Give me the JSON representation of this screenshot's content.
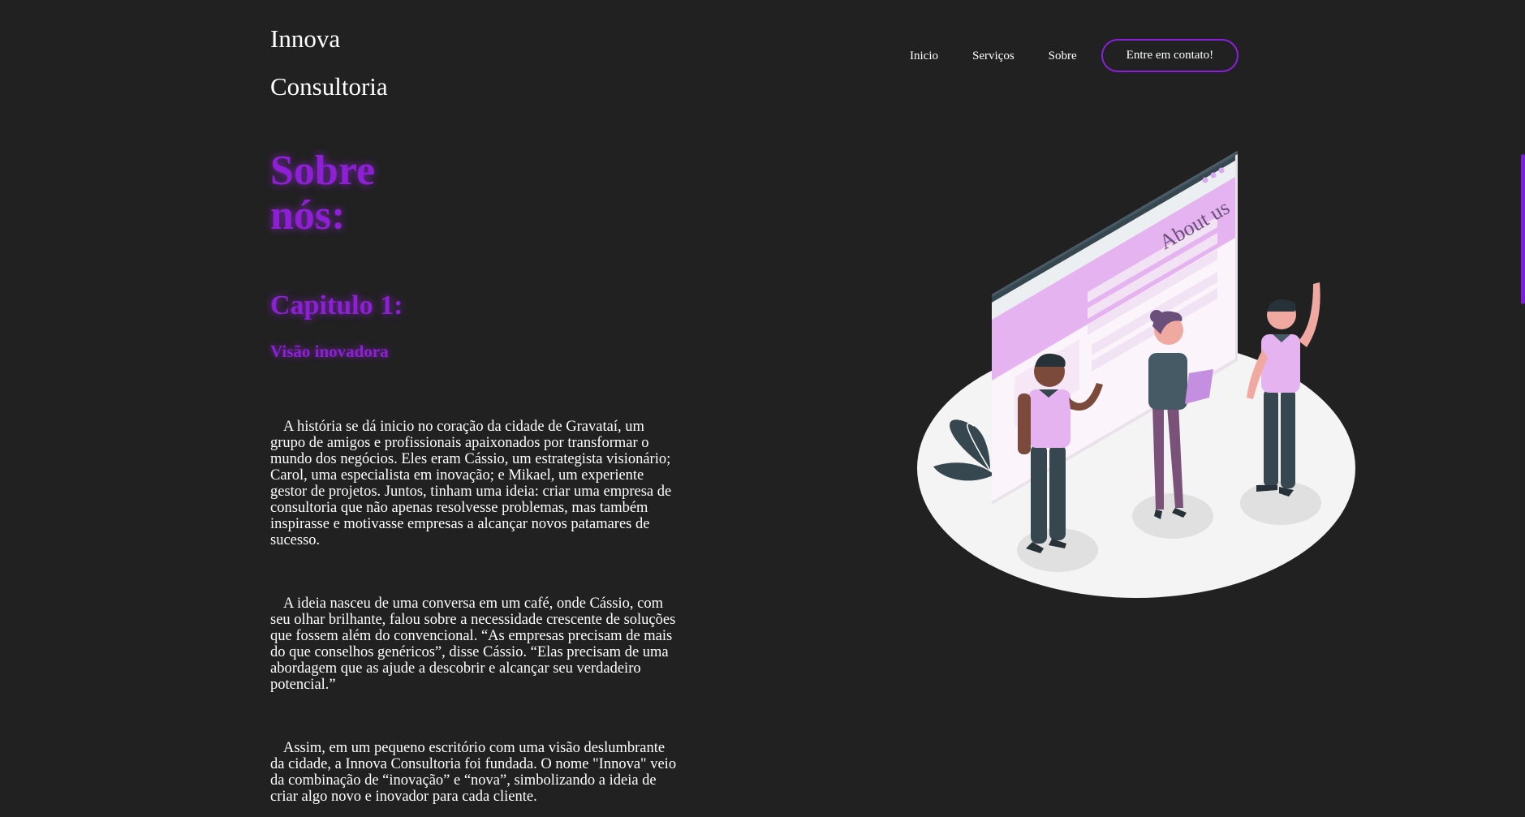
{
  "brand": {
    "line1": "Innova",
    "line2": "Consultoria"
  },
  "nav": {
    "items": [
      "Inicio",
      "Serviços",
      "Sobre"
    ],
    "cta": "Entre em contato!"
  },
  "hero": {
    "title_line1": "Sobre",
    "title_line2": "nós:",
    "chapter": "Capitulo 1:",
    "subtitle": "Visão inovadora"
  },
  "story": {
    "paragraphs": [
      "A história se dá inicio no coração da cidade de Gravataí, um grupo de amigos e profissionais apaixonados por transformar o mundo dos negócios. Eles eram Cássio, um estrategista visionário; Carol, uma especialista em inovação; e Mikael, um experiente gestor de projetos. Juntos, tinham uma ideia: criar uma empresa de consultoria que não apenas resolvesse problemas, mas também inspirasse e motivasse empresas a alcançar novos patamares de sucesso.",
      "A ideia nasceu de uma conversa em um café, onde Cássio, com seu olhar brilhante, falou sobre a necessidade crescente de soluções que fossem além do convencional. “As empresas precisam de mais do que conselhos genéricos”, disse Cássio. “Elas precisam de uma abordagem que as ajude a descobrir e alcançar seu verdadeiro potencial.”",
      "Assim, em um pequeno escritório com uma visão deslumbrante da cidade, a Innova Consultoria foi fundada. O nome \"Innova\" veio da combinação de “inovação” e “nova”, simbolizando a ideia de criar algo novo e inovador para cada cliente."
    ]
  },
  "illustration": {
    "browser_heading": "About us",
    "icon": "about-us-team-illustration"
  },
  "colors": {
    "background": "#212121",
    "accent": "#8e1fd6",
    "lavender": "#d9a9f2",
    "text": "#ffffff"
  }
}
